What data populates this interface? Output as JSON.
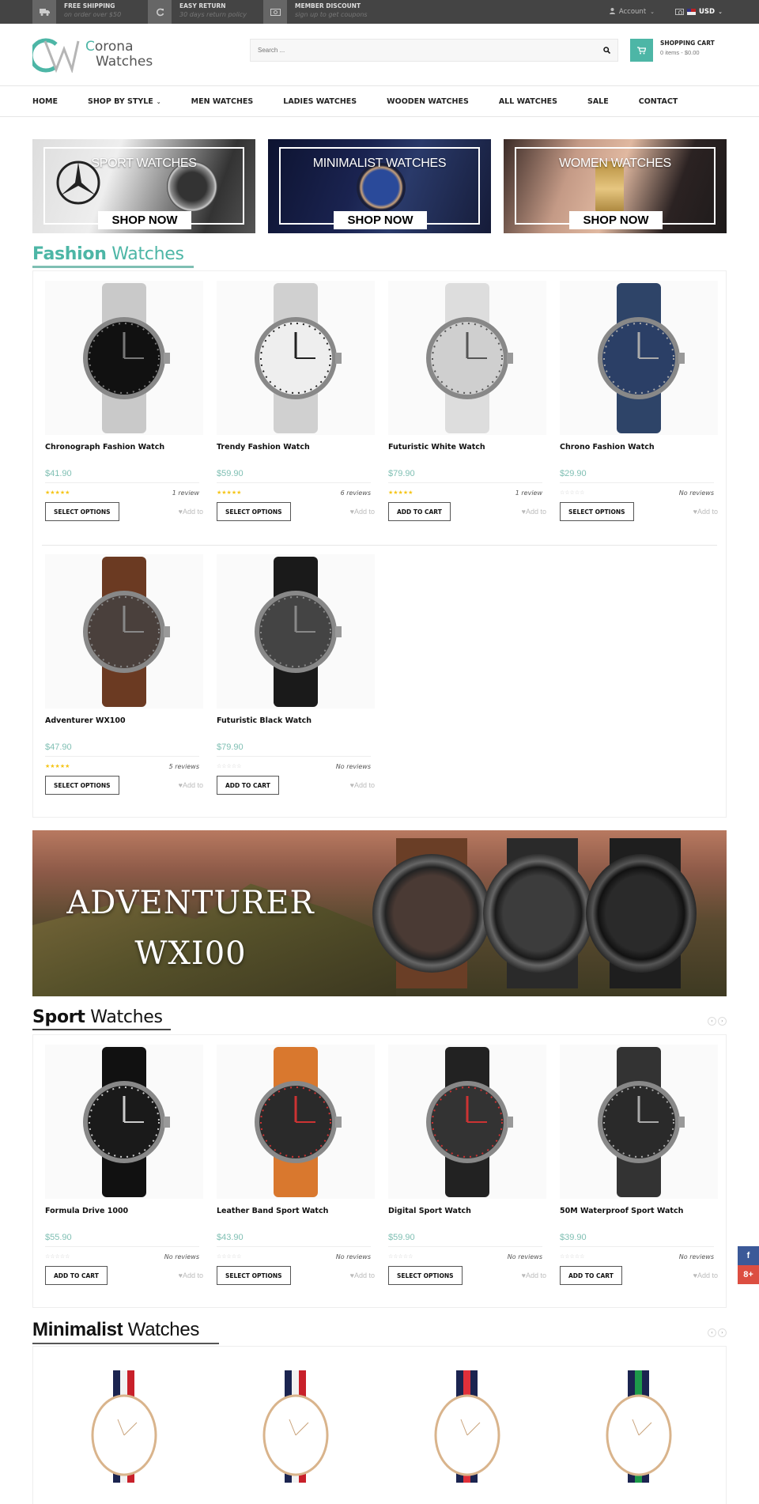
{
  "topbar": {
    "promos": [
      {
        "icon": "truck-icon",
        "title": "FREE SHIPPING",
        "subtitle": "on order over $50"
      },
      {
        "icon": "refresh-icon",
        "title": "EASY RETURN",
        "subtitle": "30 days return policy"
      },
      {
        "icon": "money-icon",
        "title": "MEMBER DISCOUNT",
        "subtitle": "sign up to get coupons"
      }
    ],
    "account_label": "Account",
    "currency_label": "USD"
  },
  "header": {
    "logo_line1_initial": "C",
    "logo_line1_rest": "orona",
    "logo_line2": "Watches",
    "search_placeholder": "Search ...",
    "cart_title": "SHOPPING CART",
    "cart_summary": "0 items - $0.00"
  },
  "nav": {
    "items": [
      "HOME",
      "SHOP BY STYLE",
      "MEN WATCHES",
      "LADIES WATCHES",
      "WOODEN WATCHES",
      "ALL WATCHES",
      "SALE",
      "CONTACT"
    ]
  },
  "banners": [
    {
      "title": "SPORT WATCHES",
      "cta": "SHOP NOW"
    },
    {
      "title": "MINIMALIST WATCHES",
      "cta": "SHOP NOW"
    },
    {
      "title": "WOMEN WATCHES",
      "cta": "SHOP NOW"
    }
  ],
  "fashion": {
    "title_bold": "Fashion",
    "title_rest": " Watches",
    "accent": "#4db6a6",
    "products": [
      {
        "name": "Chronograph Fashion Watch",
        "price": "$41.90",
        "rated": true,
        "reviews": "1 review",
        "action": "SELECT OPTIONS",
        "wishlist": "Add to Wishlist"
      },
      {
        "name": "Trendy Fashion Watch",
        "price": "$59.90",
        "rated": true,
        "reviews": "6 reviews",
        "action": "SELECT OPTIONS",
        "wishlist": "Add to Wishlist"
      },
      {
        "name": "Futuristic White Watch",
        "price": "$79.90",
        "rated": true,
        "reviews": "1 review",
        "action": "ADD TO CART",
        "wishlist": "Add to Wishlist"
      },
      {
        "name": "Chrono Fashion Watch",
        "price": "$29.90",
        "rated": false,
        "reviews": "No reviews",
        "action": "SELECT OPTIONS",
        "wishlist": "Add to Wishlist"
      },
      {
        "name": "Adventurer WX100",
        "price": "$47.90",
        "rated": true,
        "reviews": "5 reviews",
        "action": "SELECT OPTIONS",
        "wishlist": "Add to Wishlist"
      },
      {
        "name": "Futuristic Black Watch",
        "price": "$79.90",
        "rated": false,
        "reviews": "No reviews",
        "action": "ADD TO CART",
        "wishlist": "Add to Wishlist"
      }
    ]
  },
  "promo_banner": {
    "line1": "ADVENTURER",
    "line2": "WXI00"
  },
  "sport": {
    "title_bold": "Sport",
    "title_rest": " Watches",
    "products": [
      {
        "name": "Formula Drive 1000",
        "price": "$55.90",
        "rated": false,
        "reviews": "No reviews",
        "action": "ADD TO CART",
        "wishlist": "Add to Wishlist"
      },
      {
        "name": "Leather Band Sport Watch",
        "price": "$43.90",
        "rated": false,
        "reviews": "No reviews",
        "action": "SELECT OPTIONS",
        "wishlist": "Add to Wishlist"
      },
      {
        "name": "Digital Sport Watch",
        "price": "$59.90",
        "rated": false,
        "reviews": "No reviews",
        "action": "SELECT OPTIONS",
        "wishlist": "Add to Wishlist"
      },
      {
        "name": "50M Waterproof Sport Watch",
        "price": "$39.90",
        "rated": false,
        "reviews": "No reviews",
        "action": "ADD TO CART",
        "wishlist": "Add to Wishlist"
      }
    ]
  },
  "minimalist": {
    "title_bold": "Minimalist",
    "title_rest": " Watches",
    "strap_colors": [
      [
        "#1b2450",
        "#f2f2f2",
        "#c8202a"
      ],
      [
        "#1b2450",
        "#f2f2f2",
        "#c8202a"
      ],
      [
        "#1b2450",
        "#e0303a",
        "#1b2450"
      ],
      [
        "#1b2450",
        "#1d9a4a",
        "#1b2450"
      ]
    ]
  },
  "social": {
    "facebook": "f",
    "google_plus": "8+"
  },
  "colors": {
    "accent": "#4db6a6",
    "price": "#7fbfb3",
    "topbar": "#444444",
    "star": "#f5c518",
    "facebook": "#3b5998",
    "google_plus": "#dc4e41"
  }
}
